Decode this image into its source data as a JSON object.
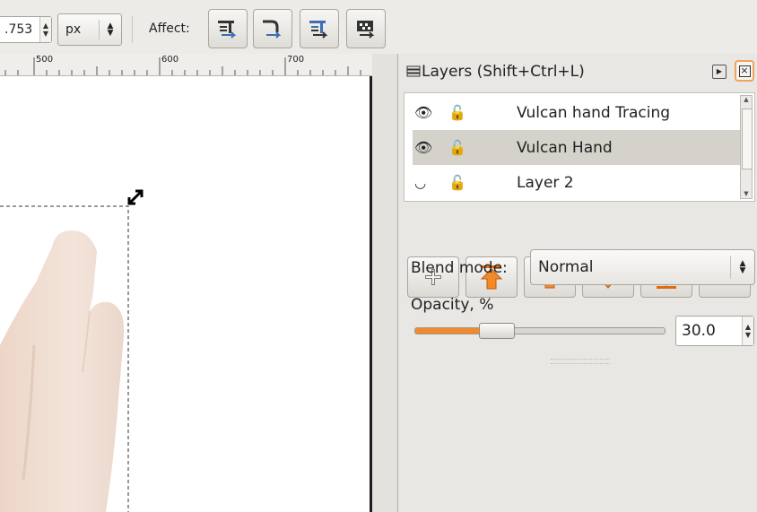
{
  "toolbar": {
    "width_value": ".753",
    "unit": "px",
    "affect_label": "Affect:",
    "affect_buttons": [
      "scale-stroke-icon",
      "scale-corners-icon",
      "move-gradients-icon",
      "move-patterns-icon"
    ]
  },
  "ruler": {
    "ticks": [
      "500",
      "600",
      "700"
    ]
  },
  "layers_panel": {
    "title": "Layers (Shift+Ctrl+L)",
    "layers": [
      {
        "name": "Vulcan hand Tracing",
        "visible": true,
        "locked": false,
        "selected": false
      },
      {
        "name": "Vulcan Hand",
        "visible": true,
        "locked": false,
        "selected": true
      },
      {
        "name": "Layer 2",
        "visible": false,
        "locked": false,
        "selected": false
      }
    ],
    "buttons": [
      "add-layer",
      "raise-to-top",
      "raise-layer",
      "lower-layer",
      "lower-to-bottom",
      "delete-layer"
    ],
    "blend_label": "Blend mode:",
    "blend_value": "Normal",
    "opacity_label": "Opacity, %",
    "opacity_value": "30.0",
    "opacity_fraction": 0.3
  },
  "colors": {
    "accent": "#f08a2c",
    "selection": "#d5d2cc"
  }
}
